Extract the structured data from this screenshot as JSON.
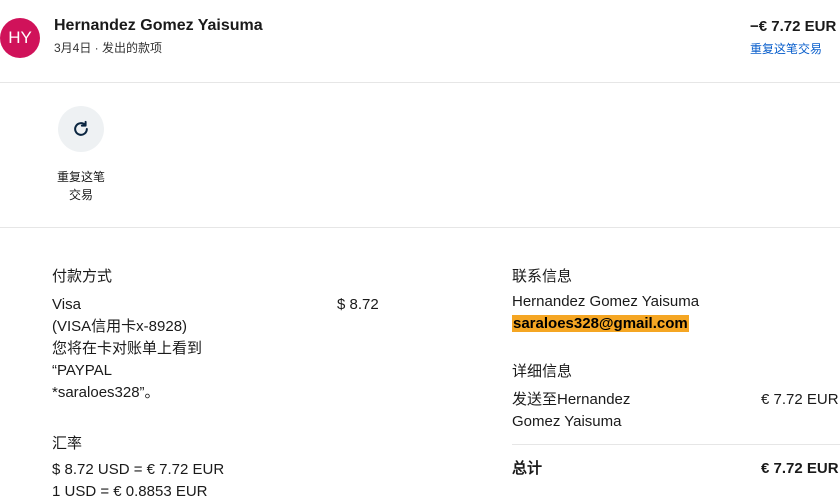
{
  "header": {
    "avatar_initials": "HY",
    "name": "Hernandez Gomez Yaisuma",
    "subtitle": "3月4日 · 发出的款项",
    "amount": "−€ 7.72 EUR",
    "repeat_link": "重复这笔交易"
  },
  "actions": {
    "repeat_line1": "重复这笔",
    "repeat_line2": "交易",
    "icon": "refresh-icon"
  },
  "payment": {
    "title": "付款方式",
    "method": "Visa",
    "card": "(VISA信用卡x-8928)",
    "statement_line1": "您将在卡对账单上看到",
    "statement_line2": "“PAYPAL",
    "statement_line3": "*saraloes328”。",
    "amount": "$ 8.72"
  },
  "exchange": {
    "title": "汇率",
    "line1": "$ 8.72 USD = € 7.72 EUR",
    "line2": "1 USD = € 0.8853 EUR"
  },
  "contact": {
    "title": "联系信息",
    "name": "Hernandez Gomez Yaisuma",
    "email": "saraloes328@gmail.com"
  },
  "details": {
    "title": "详细信息",
    "sent_to_line1": "发送至Hernandez",
    "sent_to_line2": "Gomez Yaisuma",
    "sent_amount": "€ 7.72 EUR",
    "total_label": "总计",
    "total_amount": "€ 7.72 EUR"
  },
  "colors": {
    "avatar_bg": "#d0125a",
    "link": "#0a5fcc",
    "email_highlight": "#f5a623"
  }
}
